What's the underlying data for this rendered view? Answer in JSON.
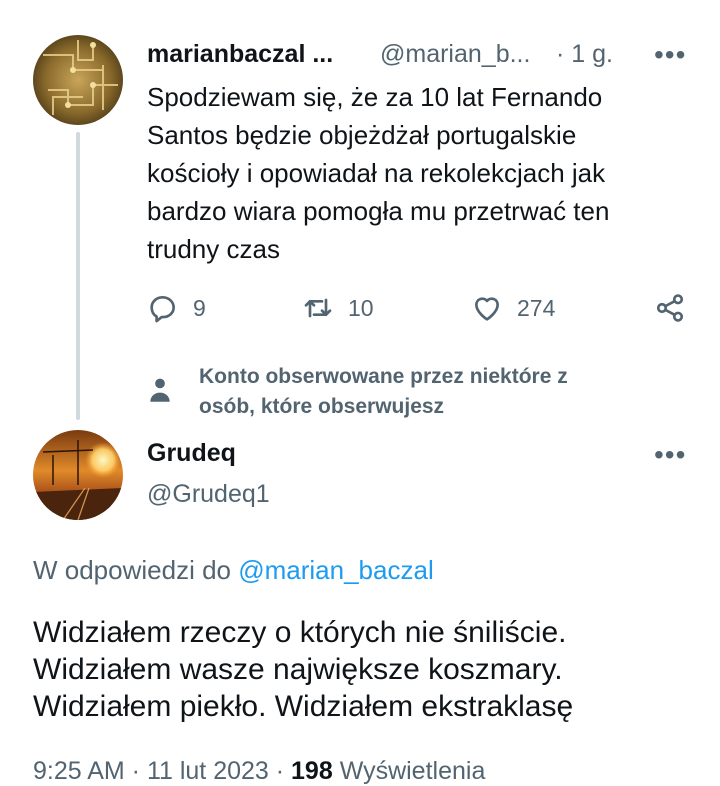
{
  "parent_tweet": {
    "display_name": "marianbaczal ...",
    "handle": "@marian_b...",
    "time": "· 1 g.",
    "more": "•••",
    "text_lines": [
      "Spodziewam się, że za 10 lat Fernando",
      "Santos będzie objeżdżał portugalskie",
      "kościoły i opowiadał na rekolekcjach jak",
      "bardzo wiara pomogła mu przetrwać ten",
      "trudny czas"
    ],
    "stats": {
      "replies": "9",
      "retweets": "10",
      "likes": "274"
    }
  },
  "social_context": {
    "line1": "Konto obserwowane przez niektóre z",
    "line2": "osób, które obserwujesz"
  },
  "main_tweet": {
    "display_name": "Grudeq",
    "handle": "@Grudeq1",
    "more": "•••",
    "reply_prefix": "W odpowiedzi do ",
    "reply_handle": "@marian_baczal",
    "text_lines": [
      "Widziałem rzeczy o których nie śniliście.",
      "Widziałem wasze największe koszmary.",
      "Widziałem piekło. Widziałem ekstraklasę"
    ],
    "time": "9:25 AM · 11 lut 2023 · ",
    "views_count": "198",
    "views_label": " Wyświetlenia"
  },
  "colors": {
    "accent": "#1d9bf0",
    "muted": "#536471",
    "text": "#0f1419",
    "thread_line": "#cfd9de"
  },
  "icons": [
    "reply-icon",
    "retweet-icon",
    "like-icon",
    "share-icon",
    "person-icon",
    "more-icon"
  ]
}
